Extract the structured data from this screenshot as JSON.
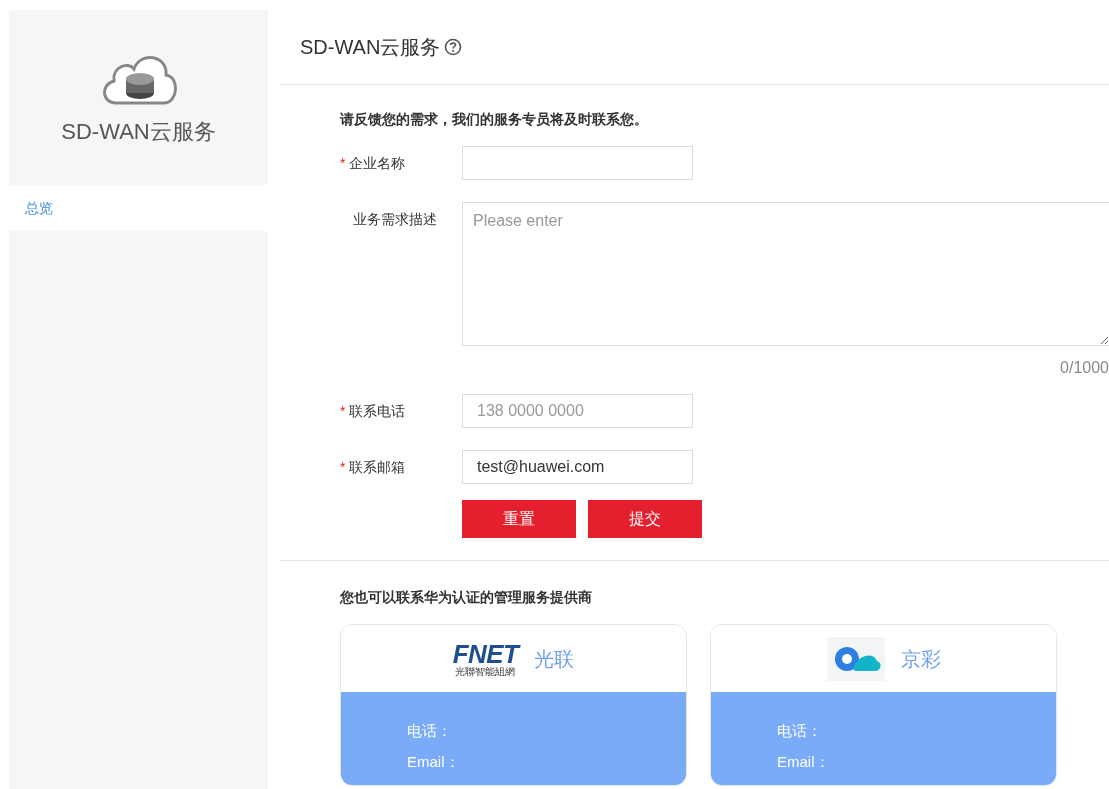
{
  "sidebar": {
    "product_title": "SD-WAN云服务",
    "items": [
      {
        "label": "总览",
        "selected": true
      }
    ]
  },
  "header": {
    "title": "SD-WAN云服务"
  },
  "form": {
    "intro": "请反馈您的需求，我们的服务专员将及时联系您。",
    "fields": [
      {
        "kind": "input",
        "label": "企业名称",
        "required_mark": "*"
      },
      {
        "kind": "textarea",
        "label": "业务需求描述",
        "placeholder": "Please enter",
        "counter": "0/1000"
      },
      {
        "kind": "input",
        "label": "联系电话",
        "required_mark": "*",
        "placeholder": "138 0000 0000"
      },
      {
        "kind": "input",
        "label": "联系邮箱",
        "required_mark": "*",
        "value": "test@huawei.com"
      }
    ],
    "buttons": [
      "重置",
      "提交"
    ]
  },
  "providers": {
    "heading": "您也可以联系华为认证的管理服务提供商",
    "cards": [
      {
        "kind": "fnet",
        "logo_text": "FNET",
        "logo_subtext": "光聯智能組網",
        "name": "光联",
        "phone_label": "电话：",
        "email_label": "Email："
      },
      {
        "kind": "cloud",
        "name": "京彩",
        "phone_label": "电话：",
        "email_label": "Email："
      }
    ]
  }
}
